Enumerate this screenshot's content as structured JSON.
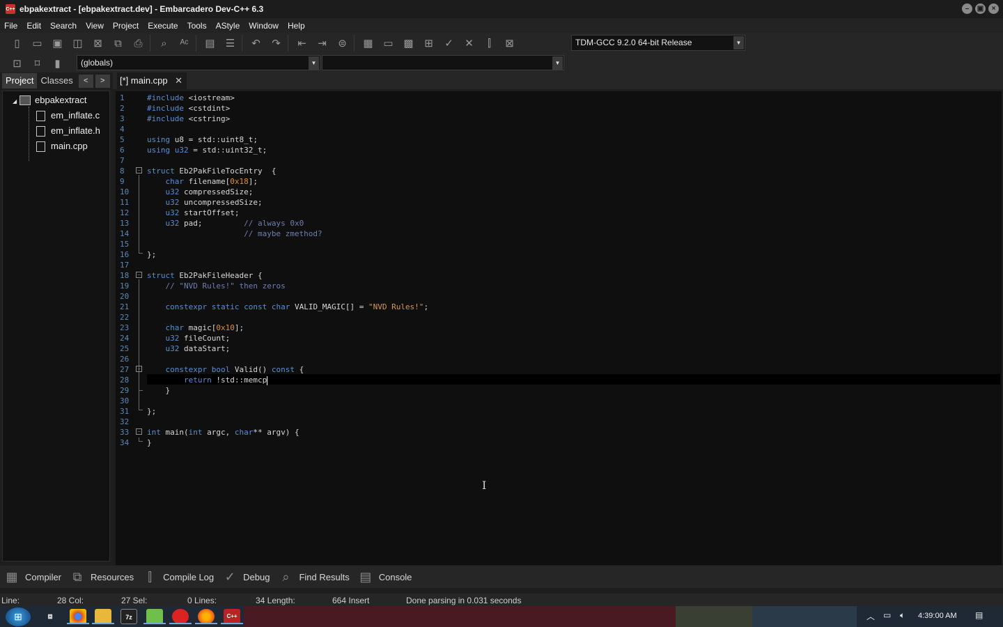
{
  "window": {
    "title": "ebpakextract - [ebpakextract.dev] - Embarcadero Dev-C++ 6.3",
    "app_icon_text": "C++",
    "controls": [
      "minimize",
      "restore",
      "close"
    ]
  },
  "menu": [
    "File",
    "Edit",
    "Search",
    "View",
    "Project",
    "Execute",
    "Tools",
    "AStyle",
    "Window",
    "Help"
  ],
  "toolbar": {
    "compiler": "TDM-GCC 9.2.0 64-bit Release",
    "scope": "(globals)",
    "function": ""
  },
  "left_panel": {
    "tabs": [
      "Project",
      "Classes"
    ],
    "active_tab": "Project",
    "project_name": "ebpakextract",
    "files": [
      "em_inflate.c",
      "em_inflate.h",
      "main.cpp"
    ]
  },
  "editor": {
    "tab_label": "[*] main.cpp",
    "current_line": 28,
    "lines": [
      "#include <iostream>",
      "#include <cstdint>",
      "#include <cstring>",
      "",
      "using u8 = std::uint8_t;",
      "using u32 = std::uint32_t;",
      "",
      "struct Eb2PakFileTocEntry  {",
      "    char filename[0x18];",
      "    u32 compressedSize;",
      "    u32 uncompressedSize;",
      "    u32 startOffset;",
      "    u32 pad;         // always 0x0",
      "                     // maybe zmethod?",
      "",
      "};",
      "",
      "struct Eb2PakFileHeader {",
      "    // \"NVD Rules!\" then zeros",
      "",
      "    constexpr static const char VALID_MAGIC[] = \"NVD Rules!\";",
      "",
      "    char magic[0x10];",
      "    u32 fileCount;",
      "    u32 dataStart;",
      "",
      "    constexpr bool Valid() const {",
      "        return !std::memcp",
      "    }",
      "",
      "};",
      "",
      "int main(int argc, char** argv) {",
      "}"
    ]
  },
  "bottom_tabs": [
    "Compiler",
    "Resources",
    "Compile Log",
    "Debug",
    "Find Results",
    "Console"
  ],
  "status": {
    "line_label": "Line:",
    "line_val": "28 Col:",
    "col_val": "27 Sel:",
    "sel_val": "0 Lines:",
    "lines_val": "34 Length:",
    "length_val": "664 Insert",
    "message": "Done parsing in 0.031 seconds"
  },
  "taskbar": {
    "clock": "4:39:00 AM",
    "apps": [
      "explorer-view",
      "chrome",
      "file-explorer",
      "7zip",
      "notepad-plus",
      "app-red",
      "firefox",
      "devcpp"
    ]
  }
}
